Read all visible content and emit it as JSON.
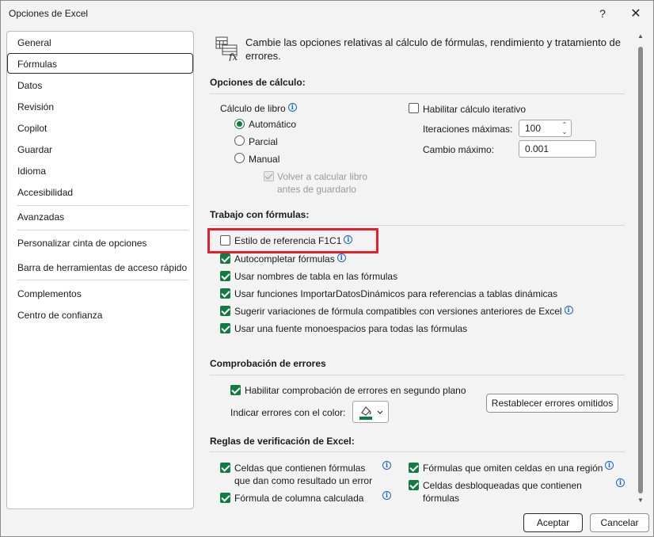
{
  "window": {
    "title": "Opciones de Excel",
    "help": "?",
    "close": "✕"
  },
  "sidebar": {
    "items": [
      {
        "label": "General"
      },
      {
        "label": "Fórmulas"
      },
      {
        "label": "Datos"
      },
      {
        "label": "Revisión"
      },
      {
        "label": "Copilot"
      },
      {
        "label": "Guardar"
      },
      {
        "label": "Idioma"
      },
      {
        "label": "Accesibilidad"
      },
      {
        "label": "Avanzadas"
      },
      {
        "label": "Personalizar cinta de opciones"
      },
      {
        "label": "Barra de herramientas de acceso rápido"
      },
      {
        "label": "Complementos"
      },
      {
        "label": "Centro de confianza"
      }
    ],
    "selected": "Fórmulas"
  },
  "header": {
    "text": "Cambie las opciones relativas al cálculo de fórmulas, rendimiento y tratamiento de errores."
  },
  "calc": {
    "title": "Opciones de cálculo:",
    "workbook_label": "Cálculo de libro",
    "auto": "Automático",
    "partial": "Parcial",
    "manual": "Manual",
    "recalc_line1": "Volver a calcular libro",
    "recalc_line2": "antes de guardarlo",
    "iterative": "Habilitar cálculo iterativo",
    "max_iter_label": "Iteraciones máximas:",
    "max_iter_value": "100",
    "max_change_label": "Cambio máximo:",
    "max_change_value": "0.001"
  },
  "formulas": {
    "title": "Trabajo con fórmulas:",
    "r1c1": "Estilo de referencia F1C1",
    "autocomplete": "Autocompletar fórmulas",
    "table_names": "Usar nombres de tabla en las fórmulas",
    "getpivot": "Usar funciones ImportarDatosDinámicos para referencias a tablas dinámicas",
    "suggest": "Sugerir variaciones de fórmula compatibles con versiones anteriores de Excel",
    "monospace": "Usar una fuente monoespacios para todas las fórmulas"
  },
  "errors": {
    "title": "Comprobación de errores",
    "enable_bg": "Habilitar comprobación de errores en segundo plano",
    "color_label": "Indicar errores con el color:",
    "reset_button": "Restablecer errores omitidos",
    "indicator_color": "#107c41"
  },
  "rules": {
    "title": "Reglas de verificación de Excel:",
    "left1_a": "Celdas que contienen fórmulas",
    "left1_b": "que dan como resultado un error",
    "left2_a": "Fórmula de columna calculada",
    "right1": "Fórmulas que omiten celdas en una región",
    "right2_a": "Celdas desbloqueadas que contienen",
    "right2_b": "fórmulas"
  },
  "footer": {
    "ok": "Aceptar",
    "cancel": "Cancelar"
  },
  "colors": {
    "accent": "#107c41",
    "highlight": "#e0212e",
    "info": "#1565c0"
  }
}
